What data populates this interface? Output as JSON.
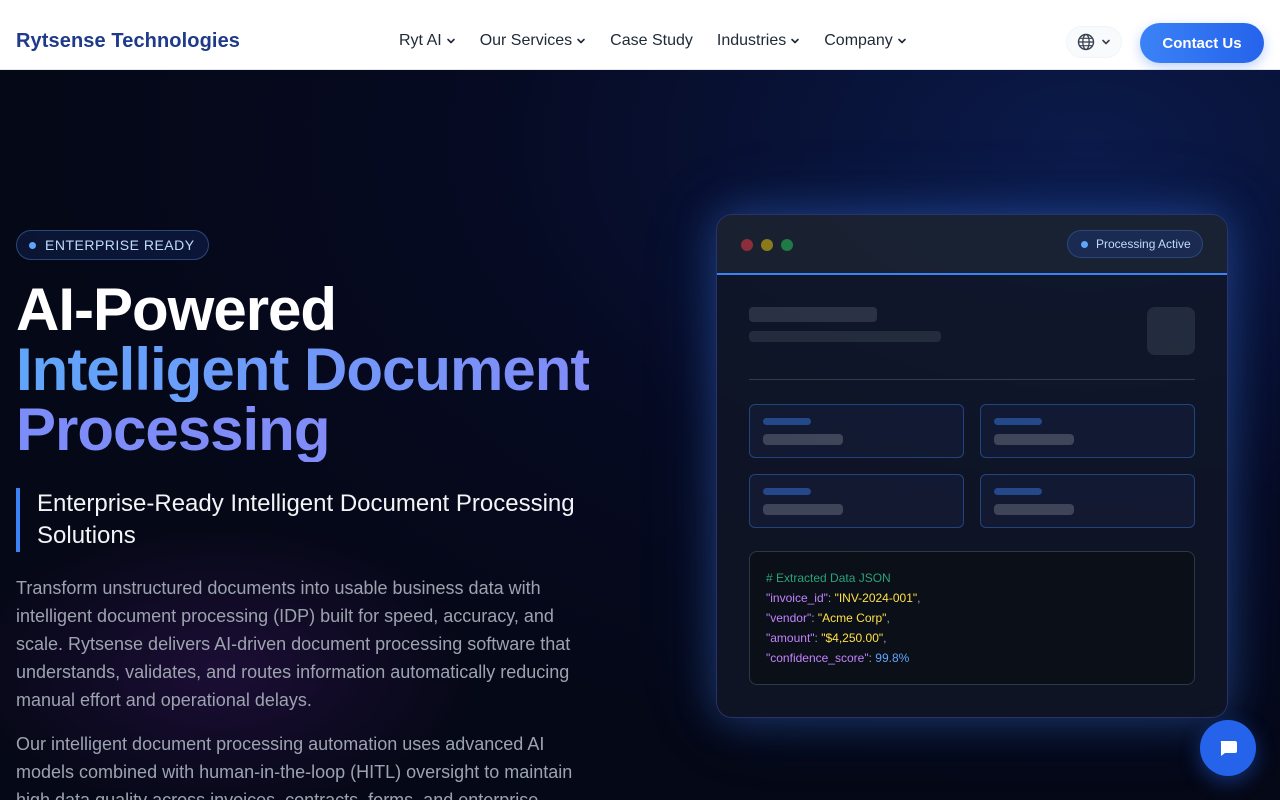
{
  "header": {
    "brand": "Rytsense Technologies",
    "nav": [
      {
        "label": "Ryt AI",
        "has_dropdown": true
      },
      {
        "label": "Our Services",
        "has_dropdown": true
      },
      {
        "label": "Case Study",
        "has_dropdown": false
      },
      {
        "label": "Industries",
        "has_dropdown": true
      },
      {
        "label": "Company",
        "has_dropdown": true
      }
    ],
    "language_icon": "globe-icon",
    "contact_label": "Contact Us"
  },
  "hero": {
    "badge": "ENTERPRISE READY",
    "title_line1": "AI-Powered",
    "title_line2": "Intelligent Document",
    "title_line3": "Processing",
    "subtitle": "Enterprise-Ready Intelligent Document Processing Solutions",
    "paragraph1": "Transform unstructured documents into usable business data with intelligent document processing (IDP) built for speed, accuracy, and scale. Rytsense delivers AI-driven document processing software that understands, validates, and routes information automatically reducing manual effort and operational delays.",
    "paragraph2": "Our intelligent document processing automation uses advanced AI models combined with human-in-the-loop (HITL) oversight to maintain high data quality across invoices, contracts, forms, and enterprise"
  },
  "mockup": {
    "status": "Processing Active",
    "code": {
      "comment": "# Extracted Data JSON",
      "lines": [
        {
          "key": "\"invoice_id\"",
          "value": "\"INV-2024-001\"",
          "trail": ","
        },
        {
          "key": "\"vendor\"",
          "value": "\"Acme Corp\"",
          "trail": ","
        },
        {
          "key": "\"amount\"",
          "value": "\"$4,250.00\"",
          "trail": ","
        },
        {
          "key": "\"confidence_score\"",
          "value": "99.8%",
          "trail": ""
        }
      ]
    }
  },
  "colors": {
    "brand": "#1e3a8a",
    "accent": "#3b82f6",
    "background": "#050816"
  },
  "chat_icon": "chat-bubble-icon"
}
